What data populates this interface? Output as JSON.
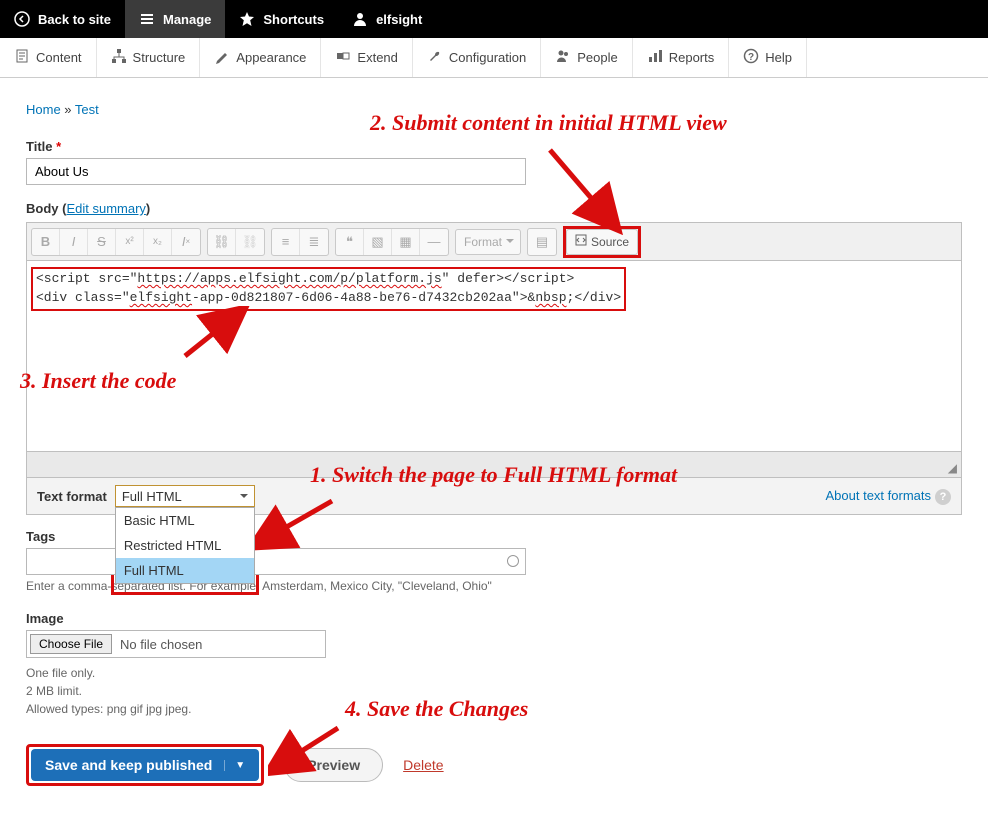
{
  "topbar": {
    "back": "Back to site",
    "manage": "Manage",
    "shortcuts": "Shortcuts",
    "user": "elfsight"
  },
  "adminTabs": {
    "content": "Content",
    "structure": "Structure",
    "appearance": "Appearance",
    "extend": "Extend",
    "configuration": "Configuration",
    "people": "People",
    "reports": "Reports",
    "help": "Help"
  },
  "breadcrumb": {
    "home": "Home",
    "sep": " » ",
    "page": "Test"
  },
  "form": {
    "titleLabel": "Title",
    "titleValue": "About Us",
    "bodyLabel": "Body",
    "editSummary": "Edit summary",
    "formatPlaceholder": "Format",
    "sourceLabel": "Source",
    "codeLine1a": "<script src=\"",
    "codeLine1b": "https://apps.elfsight.com/p/platform.js",
    "codeLine1c": "\" defer></script>",
    "codeLine2a": "<div class=\"",
    "codeLine2b": "elfsight",
    "codeLine2c": "-app-0d821807-6d06-4a88-be76-d7432cb202aa\">&",
    "codeLine2d": "nbsp",
    "codeLine2e": ";</div>",
    "textFormatLabel": "Text format",
    "textFormatSelected": "Full HTML",
    "textFormatOptions": [
      "Basic HTML",
      "Restricted HTML",
      "Full HTML"
    ],
    "aboutFormats": "About text formats",
    "tagsLabel": "Tags",
    "tagsHint": "Enter a comma-separated list. For example: Amsterdam, Mexico City, \"Cleveland, Ohio\"",
    "imageLabel": "Image",
    "chooseFile": "Choose File",
    "noFile": "No file chosen",
    "fileMeta1": "One file only.",
    "fileMeta2": "2 MB limit.",
    "fileMeta3": "Allowed types: png gif jpg jpeg.",
    "save": "Save and keep published",
    "preview": "Preview",
    "delete": "Delete"
  },
  "annotations": {
    "a1": "1. Switch the page to Full HTML format",
    "a2": "2. Submit content in initial HTML view",
    "a3": "3. Insert the code",
    "a4": "4. Save the Changes"
  }
}
